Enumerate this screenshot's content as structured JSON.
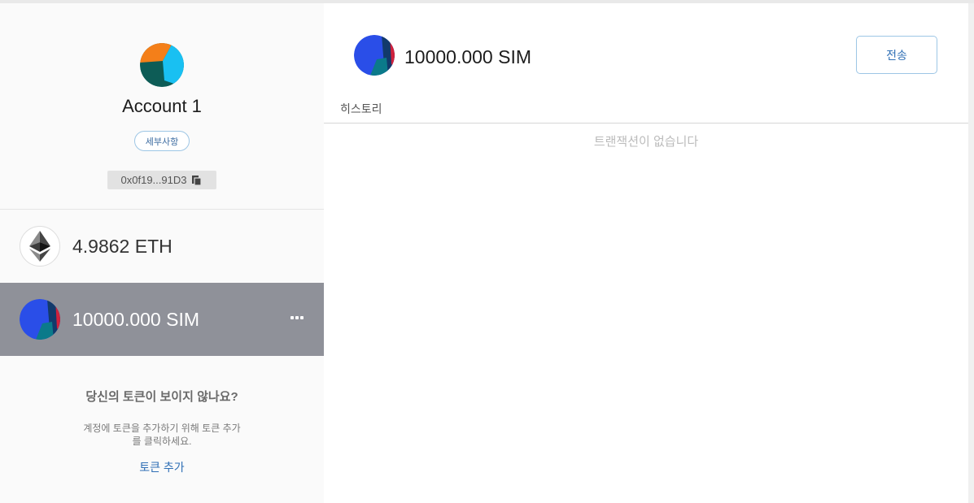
{
  "account": {
    "name": "Account 1",
    "details_label": "세부사항",
    "address": "0x0f19...91D3"
  },
  "tokens": [
    {
      "amount": "4.9862 ETH",
      "icon": "ethereum-icon"
    },
    {
      "amount": "10000.000 SIM",
      "icon": "sim-token-avatar",
      "selected": true
    }
  ],
  "add_token": {
    "title": "당신의 토큰이 보이지 않나요?",
    "description": "계정에 토큰을 추가하기 위해 토큰 추가를 클릭하세요.",
    "link": "토큰 추가"
  },
  "main": {
    "balance": "10000.000 SIM",
    "send_label": "전송",
    "history_label": "히스토리",
    "empty_message": "트랜잭션이 없습니다"
  },
  "colors": {
    "selected_row": "#8f9199",
    "link": "#2f6fb5",
    "button_border": "#9dc6e5"
  }
}
